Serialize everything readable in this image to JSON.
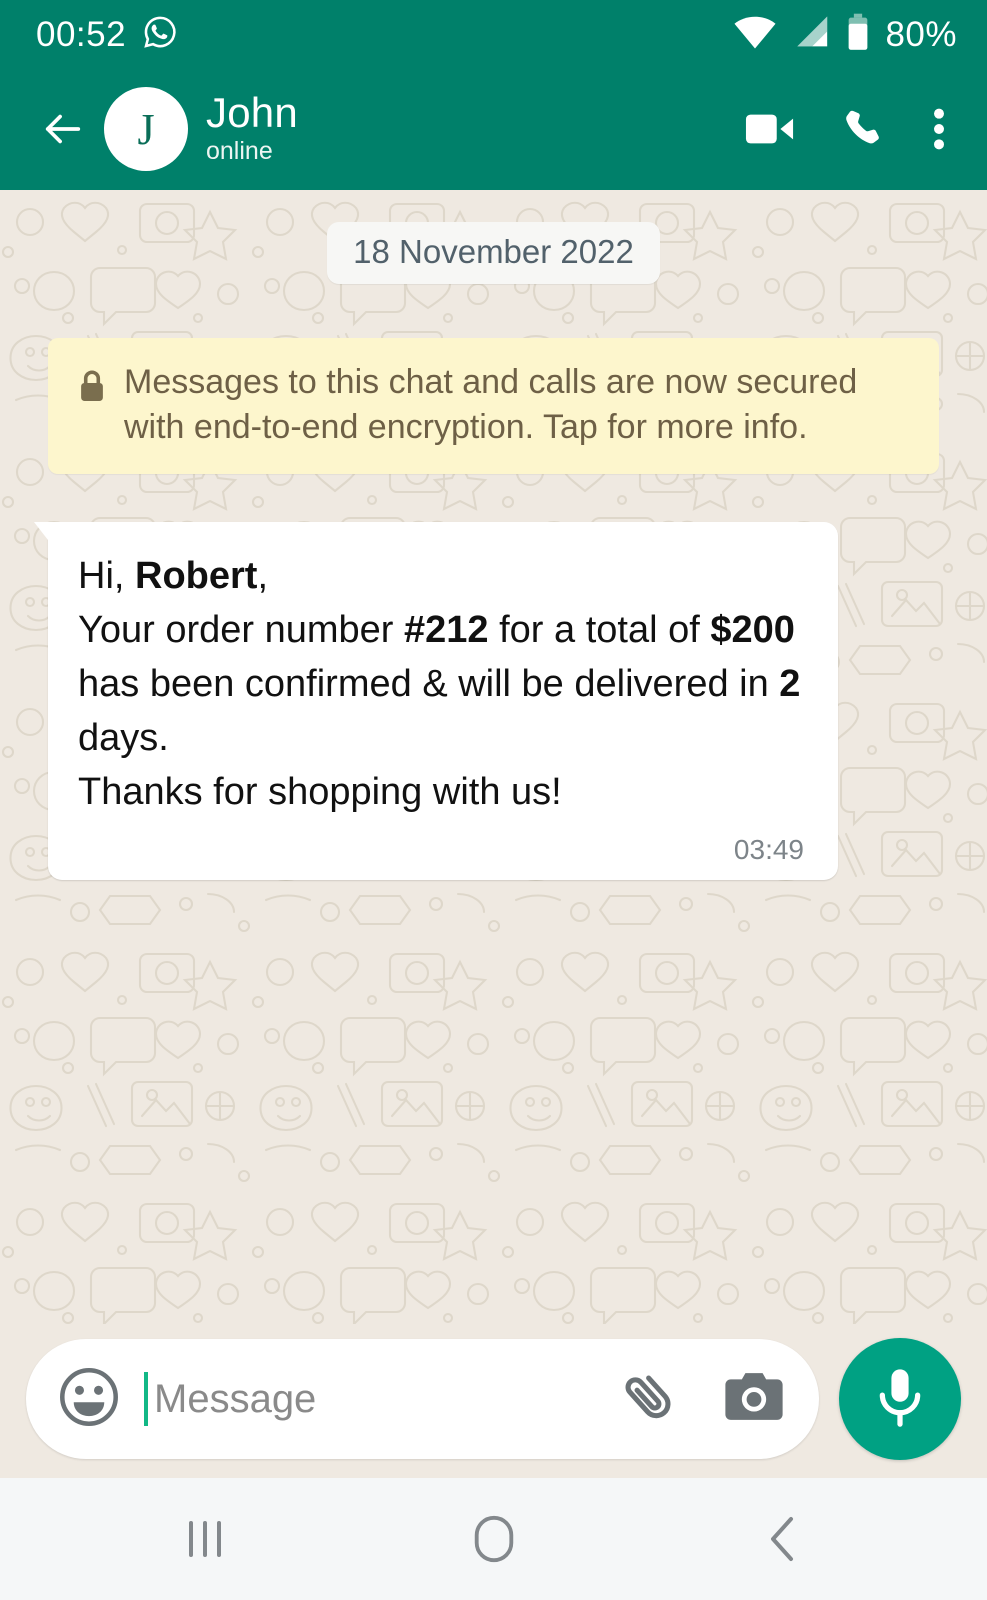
{
  "status_bar": {
    "time": "00:52",
    "notification_icon": "whatsapp-icon",
    "wifi_icon": "wifi-icon",
    "signal_icon": "cellular-signal-icon",
    "battery_icon": "battery-icon",
    "battery_text": "80%"
  },
  "header": {
    "back_icon": "back-arrow-icon",
    "avatar_initial": "J",
    "contact_name": "John",
    "contact_status": "online",
    "video_call_icon": "video-call-icon",
    "voice_call_icon": "phone-call-icon",
    "overflow_icon": "more-options-icon"
  },
  "chat": {
    "date_divider": "18 November 2022",
    "encryption_notice": {
      "lock_icon": "lock-icon",
      "text": "Messages to this chat and calls are now secured with end-to-end encryption. Tap for more info."
    },
    "messages": [
      {
        "direction": "incoming",
        "lines": [
          [
            {
              "t": "Hi, ",
              "b": false
            },
            {
              "t": "Robert",
              "b": true
            },
            {
              "t": ",",
              "b": false
            }
          ],
          [
            {
              "t": "Your order number ",
              "b": false
            },
            {
              "t": "#212",
              "b": true
            },
            {
              "t": " for a total of ",
              "b": false
            },
            {
              "t": "$200",
              "b": true
            },
            {
              "t": " has been confirmed & will be delivered in ",
              "b": false
            },
            {
              "t": "2",
              "b": true
            },
            {
              "t": " days.",
              "b": false
            }
          ],
          [
            {
              "t": "Thanks for shopping with us!",
              "b": false
            }
          ]
        ],
        "time": "03:49"
      }
    ]
  },
  "composer": {
    "emoji_icon": "emoji-icon",
    "placeholder": "Message",
    "value": "",
    "attach_icon": "attachment-paperclip-icon",
    "camera_icon": "camera-icon",
    "mic_icon": "microphone-icon"
  },
  "nav_bar": {
    "recents_icon": "recent-apps-icon",
    "home_icon": "home-icon",
    "back_icon": "system-back-icon"
  },
  "colors": {
    "header_green": "#00806A",
    "mic_green": "#00A183",
    "chat_bg": "#EFE9E1",
    "bubble_white": "#FFFFFF",
    "encryption_yellow": "#FDF6CD",
    "nav_bg": "#F5F7F8",
    "caret_green": "#12B886"
  }
}
